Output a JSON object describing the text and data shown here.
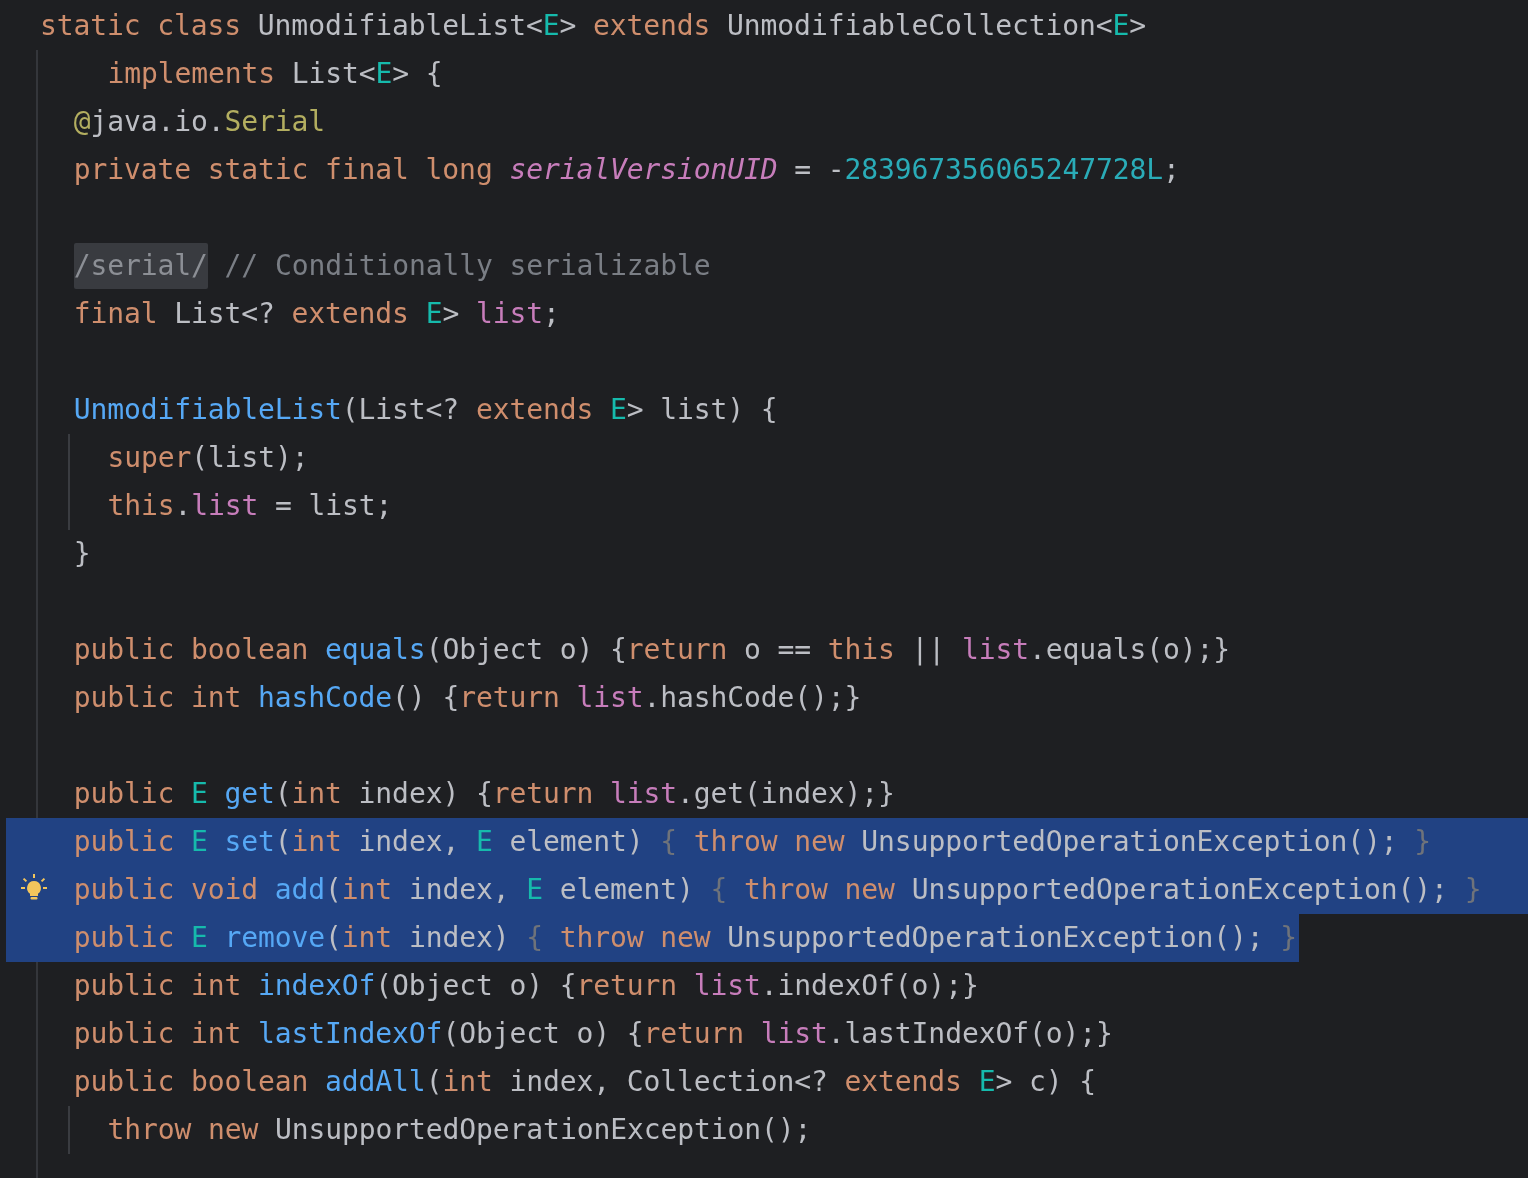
{
  "editor": {
    "lines": [
      {
        "kind": "header",
        "selected": false,
        "bulb": false,
        "tokens": [
          {
            "text": "static class ",
            "kind": "keyword"
          },
          {
            "text": "UnmodifiableList<",
            "kind": "plain"
          },
          {
            "text": "E",
            "kind": "typeparam"
          },
          {
            "text": "> ",
            "kind": "plain"
          },
          {
            "text": "extends ",
            "kind": "keyword"
          },
          {
            "text": "UnmodifiableCollection<",
            "kind": "plain"
          },
          {
            "text": "E",
            "kind": "typeparam"
          },
          {
            "text": ">",
            "kind": "plain"
          }
        ]
      },
      {
        "kind": "continuation",
        "selected": false,
        "bulb": false,
        "tokens": [
          {
            "text": "implements ",
            "kind": "keyword"
          },
          {
            "text": "List<",
            "kind": "plain"
          },
          {
            "text": "E",
            "kind": "typeparam"
          },
          {
            "text": "> {",
            "kind": "plain"
          }
        ]
      },
      {
        "kind": "member",
        "selected": false,
        "bulb": false,
        "tokens": [
          {
            "text": "@",
            "kind": "annotation"
          },
          {
            "text": "java.io.",
            "kind": "plain"
          },
          {
            "text": "Serial",
            "kind": "annotation"
          }
        ]
      },
      {
        "kind": "member",
        "selected": false,
        "bulb": false,
        "tokens": [
          {
            "text": "private static final long ",
            "kind": "keyword"
          },
          {
            "text": "serialVersionUID",
            "kind": "static_field"
          },
          {
            "text": " = -",
            "kind": "plain"
          },
          {
            "text": "283967356065247728L",
            "kind": "number"
          },
          {
            "text": ";",
            "kind": "plain"
          }
        ]
      },
      {
        "kind": "blank"
      },
      {
        "kind": "member",
        "selected": false,
        "bulb": false,
        "tokens": [
          {
            "text": "/serial/",
            "kind": "hint"
          },
          {
            "text": "// Conditionally serializable",
            "kind": "comment"
          }
        ]
      },
      {
        "kind": "member",
        "selected": false,
        "bulb": false,
        "tokens": [
          {
            "text": "final ",
            "kind": "keyword"
          },
          {
            "text": "List<? ",
            "kind": "plain"
          },
          {
            "text": "extends ",
            "kind": "keyword"
          },
          {
            "text": "E",
            "kind": "typeparam"
          },
          {
            "text": "> ",
            "kind": "plain"
          },
          {
            "text": "list",
            "kind": "field"
          },
          {
            "text": ";",
            "kind": "plain"
          }
        ]
      },
      {
        "kind": "blank"
      },
      {
        "kind": "member",
        "selected": false,
        "bulb": false,
        "tokens": [
          {
            "text": "UnmodifiableList",
            "kind": "declaration"
          },
          {
            "text": "(List<? ",
            "kind": "plain"
          },
          {
            "text": "extends ",
            "kind": "keyword"
          },
          {
            "text": "E",
            "kind": "typeparam"
          },
          {
            "text": "> list) {",
            "kind": "plain"
          }
        ]
      },
      {
        "kind": "body",
        "selected": false,
        "bulb": false,
        "tokens": [
          {
            "text": "super",
            "kind": "keyword"
          },
          {
            "text": "(list);",
            "kind": "plain"
          }
        ]
      },
      {
        "kind": "body",
        "selected": false,
        "bulb": false,
        "tokens": [
          {
            "text": "this",
            "kind": "keyword"
          },
          {
            "text": ".list",
            "kind": "field_access"
          },
          {
            "text": " = list;",
            "kind": "plain"
          }
        ]
      },
      {
        "kind": "member",
        "selected": false,
        "bulb": false,
        "tokens": [
          {
            "text": "}",
            "kind": "plain"
          }
        ]
      },
      {
        "kind": "blank"
      },
      {
        "kind": "member",
        "selected": false,
        "bulb": false,
        "tokens": [
          {
            "text": "public boolean ",
            "kind": "keyword"
          },
          {
            "text": "equals",
            "kind": "declaration"
          },
          {
            "text": "(Object o) {",
            "kind": "plain"
          },
          {
            "text": "return ",
            "kind": "keyword"
          },
          {
            "text": "o == ",
            "kind": "plain"
          },
          {
            "text": "this",
            "kind": "keyword"
          },
          {
            "text": " || ",
            "kind": "plain"
          },
          {
            "text": "list",
            "kind": "field"
          },
          {
            "text": ".equals(o);}",
            "kind": "plain"
          }
        ]
      },
      {
        "kind": "member",
        "selected": false,
        "bulb": false,
        "tokens": [
          {
            "text": "public int ",
            "kind": "keyword"
          },
          {
            "text": "hashCode",
            "kind": "declaration"
          },
          {
            "text": "() {",
            "kind": "plain"
          },
          {
            "text": "return ",
            "kind": "keyword"
          },
          {
            "text": "list",
            "kind": "field"
          },
          {
            "text": ".hashCode();}",
            "kind": "plain"
          }
        ]
      },
      {
        "kind": "blank"
      },
      {
        "kind": "member",
        "selected": false,
        "bulb": false,
        "tokens": [
          {
            "text": "public ",
            "kind": "keyword"
          },
          {
            "text": "E ",
            "kind": "typeparam"
          },
          {
            "text": "get",
            "kind": "declaration"
          },
          {
            "text": "(",
            "kind": "plain"
          },
          {
            "text": "int ",
            "kind": "keyword"
          },
          {
            "text": "index) {",
            "kind": "plain"
          },
          {
            "text": "return ",
            "kind": "keyword"
          },
          {
            "text": "list",
            "kind": "field"
          },
          {
            "text": ".get(index);}",
            "kind": "plain"
          }
        ]
      },
      {
        "kind": "member",
        "selected": true,
        "bulb": false,
        "tokens": [
          {
            "text": "public ",
            "kind": "keyword"
          },
          {
            "text": "E ",
            "kind": "typeparam"
          },
          {
            "text": "set",
            "kind": "declaration"
          },
          {
            "text": "(",
            "kind": "plain"
          },
          {
            "text": "int ",
            "kind": "keyword"
          },
          {
            "text": "index, ",
            "kind": "plain"
          },
          {
            "text": "E ",
            "kind": "typeparam"
          },
          {
            "text": "element) ",
            "kind": "plain"
          },
          {
            "text": "{ ",
            "kind": "fold"
          },
          {
            "text": "throw new ",
            "kind": "keyword"
          },
          {
            "text": "UnsupportedOperationException(); ",
            "kind": "plain"
          },
          {
            "text": "}",
            "kind": "fold"
          }
        ]
      },
      {
        "kind": "member",
        "selected": true,
        "bulb": true,
        "tokens": [
          {
            "text": "public void ",
            "kind": "keyword"
          },
          {
            "text": "add",
            "kind": "declaration"
          },
          {
            "text": "(",
            "kind": "plain"
          },
          {
            "text": "int ",
            "kind": "keyword"
          },
          {
            "text": "index, ",
            "kind": "plain"
          },
          {
            "text": "E ",
            "kind": "typeparam"
          },
          {
            "text": "element) ",
            "kind": "plain"
          },
          {
            "text": "{ ",
            "kind": "fold"
          },
          {
            "text": "throw new ",
            "kind": "keyword"
          },
          {
            "text": "UnsupportedOperationException(); ",
            "kind": "plain"
          },
          {
            "text": "}",
            "kind": "fold"
          }
        ]
      },
      {
        "kind": "member",
        "selected": true,
        "bulb": false,
        "tokens": [
          {
            "text": "public ",
            "kind": "keyword"
          },
          {
            "text": "E ",
            "kind": "typeparam"
          },
          {
            "text": "remove",
            "kind": "declaration"
          },
          {
            "text": "(",
            "kind": "plain"
          },
          {
            "text": "int ",
            "kind": "keyword"
          },
          {
            "text": "index) ",
            "kind": "plain"
          },
          {
            "text": "{ ",
            "kind": "fold"
          },
          {
            "text": "throw new ",
            "kind": "keyword"
          },
          {
            "text": "UnsupportedOperationException(); ",
            "kind": "plain"
          },
          {
            "text": "}",
            "kind": "fold"
          }
        ]
      },
      {
        "kind": "member",
        "selected": false,
        "bulb": false,
        "tokens": [
          {
            "text": "public int ",
            "kind": "keyword"
          },
          {
            "text": "indexOf",
            "kind": "declaration"
          },
          {
            "text": "(Object o) {",
            "kind": "plain"
          },
          {
            "text": "return ",
            "kind": "keyword"
          },
          {
            "text": "list",
            "kind": "field"
          },
          {
            "text": ".indexOf(o);}",
            "kind": "plain"
          }
        ]
      },
      {
        "kind": "member",
        "selected": false,
        "bulb": false,
        "tokens": [
          {
            "text": "public int ",
            "kind": "keyword"
          },
          {
            "text": "lastIndexOf",
            "kind": "declaration"
          },
          {
            "text": "(Object o) {",
            "kind": "plain"
          },
          {
            "text": "return ",
            "kind": "keyword"
          },
          {
            "text": "list",
            "kind": "field"
          },
          {
            "text": ".lastIndexOf(o);}",
            "kind": "plain"
          }
        ]
      },
      {
        "kind": "member",
        "selected": false,
        "bulb": false,
        "tokens": [
          {
            "text": "public boolean ",
            "kind": "keyword"
          },
          {
            "text": "addAll",
            "kind": "declaration"
          },
          {
            "text": "(",
            "kind": "plain"
          },
          {
            "text": "int ",
            "kind": "keyword"
          },
          {
            "text": "index, Collection<? ",
            "kind": "plain"
          },
          {
            "text": "extends ",
            "kind": "keyword"
          },
          {
            "text": "E",
            "kind": "typeparam"
          },
          {
            "text": "> c) {",
            "kind": "plain"
          }
        ]
      },
      {
        "kind": "body",
        "selected": false,
        "bulb": false,
        "tokens": [
          {
            "text": "throw new ",
            "kind": "keyword"
          },
          {
            "text": "UnsupportedOperationException();",
            "kind": "plain"
          }
        ]
      }
    ]
  }
}
